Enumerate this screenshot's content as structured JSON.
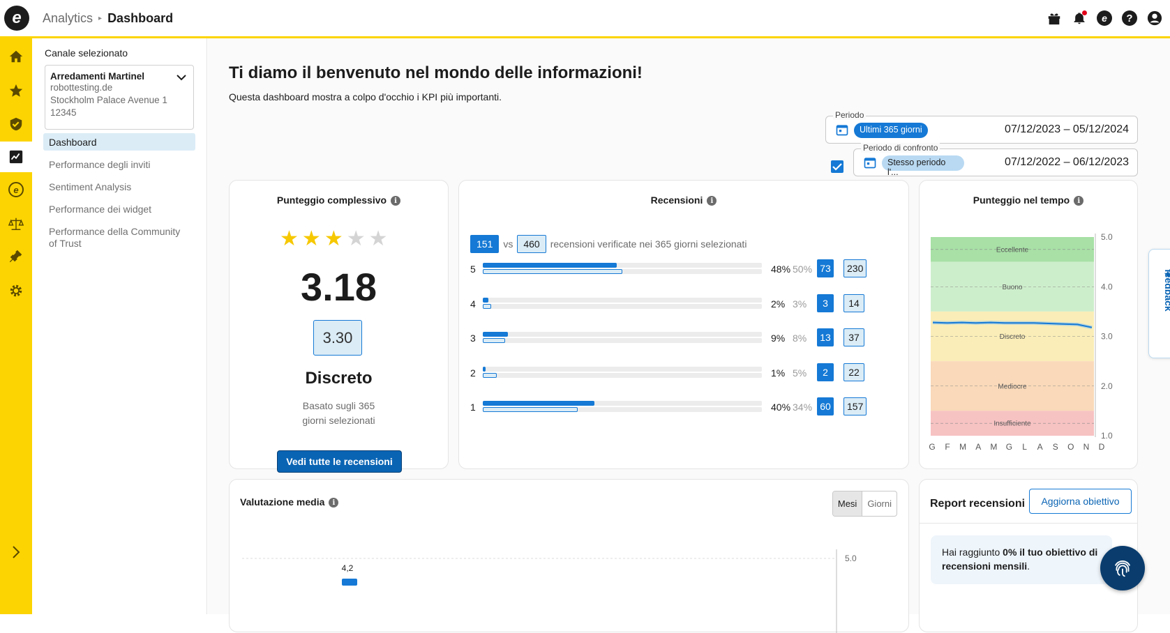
{
  "header": {
    "breadcrumb_parent": "Analytics",
    "breadcrumb_current": "Dashboard"
  },
  "sidebar": {
    "channel_label": "Canale selezionato",
    "channel": {
      "name": "Arredamenti Martinel",
      "domain": "robottesting.de",
      "address": "Stockholm Palace Avenue 1",
      "zip": "12345"
    },
    "items": [
      {
        "label": "Dashboard",
        "active": true
      },
      {
        "label": "Performance degli inviti"
      },
      {
        "label": "Sentiment Analysis"
      },
      {
        "label": "Performance dei widget"
      },
      {
        "label": "Performance della Community of Trust"
      }
    ]
  },
  "page": {
    "title": "Ti diamo il benvenuto nel mondo delle informazioni!",
    "subtitle": "Questa dashboard mostra a colpo d'occhio i KPI più importanti."
  },
  "period": {
    "label": "Periodo",
    "chip": "Ultimi 365 giorni",
    "range": "07/12/2023 – 05/12/2024"
  },
  "compare": {
    "label": "Periodo di confronto",
    "chip": "Stesso periodo l'...",
    "range": "07/12/2022 – 06/12/2023",
    "checked": true
  },
  "score_card": {
    "title": "Punteggio complessivo",
    "stars_filled": 3,
    "stars_total": 5,
    "score": "3.18",
    "compare_score": "3.30",
    "rating_label": "Discreto",
    "note_line1": "Basato sugli 365",
    "note_line2": "giorni selezionati",
    "button": "Vedi tutte le recensioni"
  },
  "reviews_card": {
    "title": "Recensioni",
    "current_total": "151",
    "vs": "vs",
    "compare_total": "460",
    "summary": "recensioni verificate nei 365 giorni selezionati",
    "rows": [
      {
        "star": "5",
        "pct": "48%",
        "pct_cmp": "50%",
        "count": "73",
        "count_cmp": "230",
        "v": 0.48,
        "vc": 0.5
      },
      {
        "star": "4",
        "pct": "2%",
        "pct_cmp": "3%",
        "count": "3",
        "count_cmp": "14",
        "v": 0.02,
        "vc": 0.03
      },
      {
        "star": "3",
        "pct": "9%",
        "pct_cmp": "8%",
        "count": "13",
        "count_cmp": "37",
        "v": 0.09,
        "vc": 0.08
      },
      {
        "star": "2",
        "pct": "1%",
        "pct_cmp": "5%",
        "count": "2",
        "count_cmp": "22",
        "v": 0.01,
        "vc": 0.05
      },
      {
        "star": "1",
        "pct": "40%",
        "pct_cmp": "34%",
        "count": "60",
        "count_cmp": "157",
        "v": 0.4,
        "vc": 0.34
      }
    ]
  },
  "time_card": {
    "title": "Punteggio nel tempo"
  },
  "chart_data": {
    "type": "line",
    "ylim": [
      1.0,
      5.0
    ],
    "yticks": [
      "5.0",
      "4.0",
      "3.0",
      "2.0",
      "1.0"
    ],
    "categories": [
      "G",
      "F",
      "M",
      "A",
      "M",
      "G",
      "L",
      "A",
      "S",
      "O",
      "N",
      "D"
    ],
    "bands": [
      {
        "label": "Eccellente",
        "from": 4.5,
        "to": 5.0,
        "color": "#a8e0a6"
      },
      {
        "label": "Buono",
        "from": 3.5,
        "to": 4.5,
        "color": "#cdeecb"
      },
      {
        "label": "Discreto",
        "from": 2.5,
        "to": 3.5,
        "color": "#faedb7"
      },
      {
        "label": "Mediocre",
        "from": 1.5,
        "to": 2.5,
        "color": "#f9d9b9"
      },
      {
        "label": "Insufficiente",
        "from": 1.0,
        "to": 1.5,
        "color": "#f7c2c2"
      }
    ],
    "values": [
      3.28,
      3.27,
      3.28,
      3.27,
      3.28,
      3.27,
      3.27,
      3.27,
      3.26,
      3.25,
      3.24,
      3.18
    ]
  },
  "feedback": {
    "label": "Invia feedback"
  },
  "avg_card": {
    "title": "Valutazione media",
    "toggle_months": "Mesi",
    "toggle_days": "Giorni",
    "y_max": "5.0",
    "first_value": "4,2"
  },
  "report_card": {
    "title": "Report recensioni",
    "button": "Aggiorna obiettivo",
    "goal_prefix": "Hai raggiunto ",
    "goal_bold": "0% il tuo obiettivo di recensioni mensili",
    "goal_suffix": "."
  },
  "colors": {
    "brand_yellow": "#fcd401",
    "primary_blue": "#1579d5",
    "dark_blue": "#0a64b4"
  }
}
